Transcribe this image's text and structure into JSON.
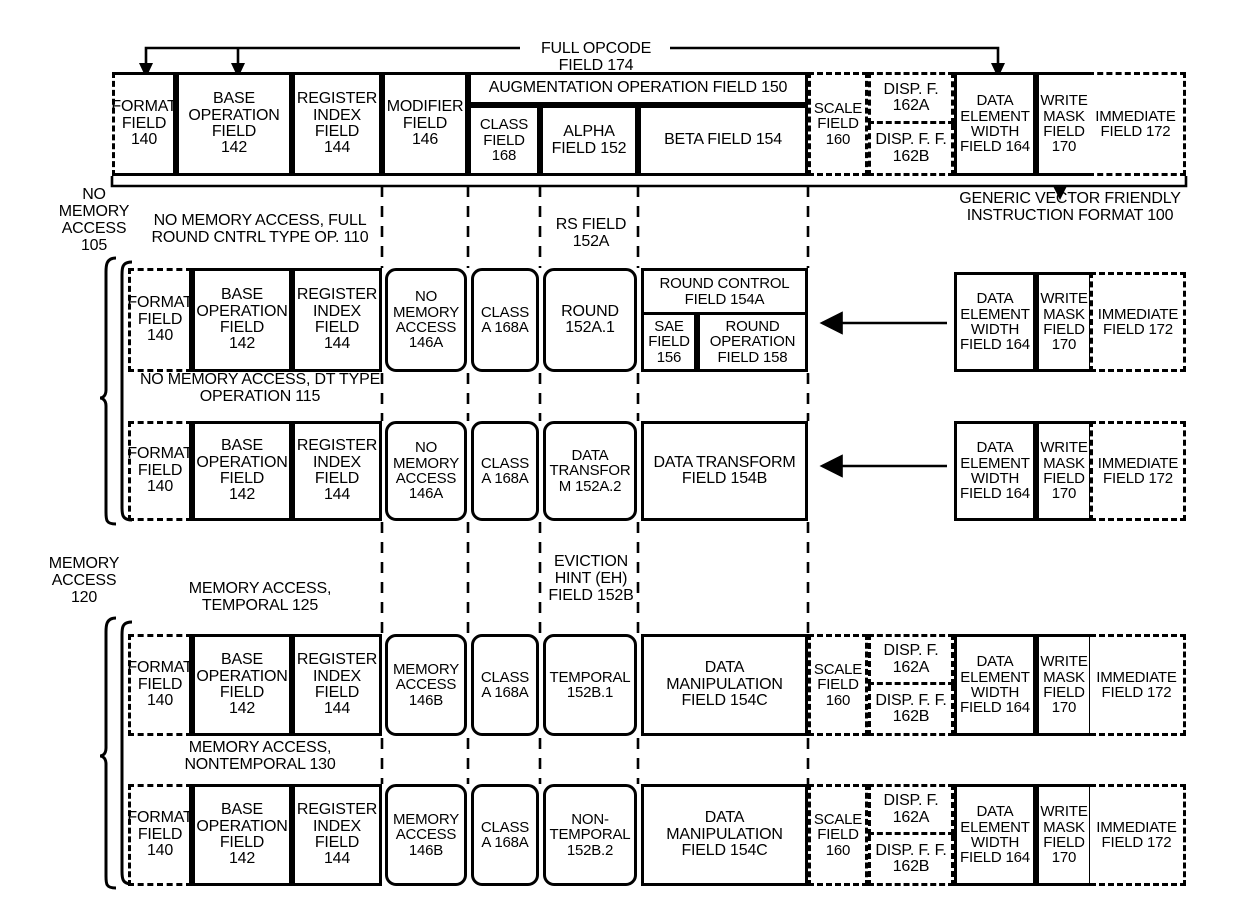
{
  "diagram": {
    "title": "GENERIC VECTOR FRIENDLY INSTRUCTION FORMAT 100",
    "full_opcode_label": "FULL OPCODE FIELD 174",
    "generic_format_label_l1": "GENERIC VECTOR FRIENDLY",
    "generic_format_label_l2": "INSTRUCTION FORMAT 100"
  },
  "group_labels": {
    "no_memory_access": "NO\nMEMORY\nACCESS\n105",
    "no_memory_access_l1": "NO",
    "no_memory_access_l2": "MEMORY",
    "no_memory_access_l3": "ACCESS",
    "no_memory_access_l4": "105",
    "memory_access_l1": "MEMORY",
    "memory_access_l2": "ACCESS",
    "memory_access_l3": "120",
    "row2_caption_l1": "NO MEMORY ACCESS, FULL",
    "row2_caption_l2": "ROUND CNTRL TYPE OP. 110",
    "row3_caption_l1": "NO MEMORY ACCESS, DT TYPE",
    "row3_caption_l2": "OPERATION 115",
    "row4_caption_l1": "MEMORY ACCESS,",
    "row4_caption_l2": "TEMPORAL 125",
    "row5_caption_l1": "MEMORY ACCESS,",
    "row5_caption_l2": "NONTEMPORAL 130",
    "rs_field_l1": "RS FIELD",
    "rs_field_l2": "152A",
    "eviction_hint_l1": "EVICTION",
    "eviction_hint_l2": "HINT (EH)",
    "eviction_hint_l3": "FIELD 152B"
  },
  "header_row": {
    "format_field": "FORMAT\nFIELD\n140",
    "format_field_l1": "FORMAT",
    "format_field_l2": "FIELD",
    "format_field_l3": "140",
    "base_operation_l1": "BASE",
    "base_operation_l2": "OPERATION",
    "base_operation_l3": "FIELD",
    "base_operation_l4": "142",
    "register_index_l1": "REGISTER",
    "register_index_l2": "INDEX",
    "register_index_l3": "FIELD",
    "register_index_l4": "144",
    "modifier_l1": "MODIFIER",
    "modifier_l2": "FIELD",
    "modifier_l3": "146",
    "augmentation": "AUGMENTATION OPERATION FIELD 150",
    "class_field_l1": "CLASS",
    "class_field_l2": "FIELD",
    "class_field_l3": "168",
    "alpha_field_l1": "ALPHA",
    "alpha_field_l2": "FIELD 152",
    "beta_field": "BETA FIELD 154",
    "scale_field_l1": "SCALE",
    "scale_field_l2": "FIELD",
    "scale_field_l3": "160",
    "disp_f_l1": "DISP. F.",
    "disp_f_l2": "162A",
    "disp_ff_l1": "DISP. F. F.",
    "disp_ff_l2": "162B",
    "data_element_width_l1": "DATA",
    "data_element_width_l2": "ELEMENT",
    "data_element_width_l3": "WIDTH",
    "data_element_width_l4": "FIELD 164",
    "write_mask_l1": "WRITE",
    "write_mask_l2": "MASK",
    "write_mask_l3": "FIELD",
    "write_mask_l4": "170",
    "immediate_l1": "IMMEDIATE",
    "immediate_l2": "FIELD 172"
  },
  "row_round": {
    "format_field_l1": "FORMAT",
    "format_field_l2": "FIELD",
    "format_field_l3": "140",
    "base_operation_l1": "BASE",
    "base_operation_l2": "OPERATION",
    "base_operation_l3": "FIELD",
    "base_operation_l4": "142",
    "register_index_l1": "REGISTER",
    "register_index_l2": "INDEX",
    "register_index_l3": "FIELD",
    "register_index_l4": "144",
    "no_mem_access_l1": "NO",
    "no_mem_access_l2": "MEMORY",
    "no_mem_access_l3": "ACCESS",
    "no_mem_access_l4": "146A",
    "class_a_l1": "CLASS",
    "class_a_l2": "A 168A",
    "round_l1": "ROUND",
    "round_l2": "152A.1",
    "round_control_l1": "ROUND CONTROL",
    "round_control_l2": "FIELD 154A",
    "sae_l1": "SAE",
    "sae_l2": "FIELD",
    "sae_l3": "156",
    "round_op_l1": "ROUND",
    "round_op_l2": "OPERATION",
    "round_op_l3": "FIELD 158",
    "data_element_width_l1": "DATA",
    "data_element_width_l2": "ELEMENT",
    "data_element_width_l3": "WIDTH",
    "data_element_width_l4": "FIELD 164",
    "write_mask_l1": "WRITE",
    "write_mask_l2": "MASK",
    "write_mask_l3": "FIELD",
    "write_mask_l4": "170",
    "immediate_l1": "IMMEDIATE",
    "immediate_l2": "FIELD 172"
  },
  "row_dt": {
    "format_field_l1": "FORMAT",
    "format_field_l2": "FIELD",
    "format_field_l3": "140",
    "base_operation_l1": "BASE",
    "base_operation_l2": "OPERATION",
    "base_operation_l3": "FIELD",
    "base_operation_l4": "142",
    "register_index_l1": "REGISTER",
    "register_index_l2": "INDEX",
    "register_index_l3": "FIELD",
    "register_index_l4": "144",
    "no_mem_access_l1": "NO",
    "no_mem_access_l2": "MEMORY",
    "no_mem_access_l3": "ACCESS",
    "no_mem_access_l4": "146A",
    "class_a_l1": "CLASS",
    "class_a_l2": "A 168A",
    "data_transform_l1": "DATA",
    "data_transform_l2": "TRANSFOR",
    "data_transform_l3": "M 152A.2",
    "data_transform_field_l1": "DATA TRANSFORM",
    "data_transform_field_l2": "FIELD 154B",
    "data_element_width_l1": "DATA",
    "data_element_width_l2": "ELEMENT",
    "data_element_width_l3": "WIDTH",
    "data_element_width_l4": "FIELD 164",
    "write_mask_l1": "WRITE",
    "write_mask_l2": "MASK",
    "write_mask_l3": "FIELD",
    "write_mask_l4": "170",
    "immediate_l1": "IMMEDIATE",
    "immediate_l2": "FIELD 172"
  },
  "row_temporal": {
    "format_field_l1": "FORMAT",
    "format_field_l2": "FIELD",
    "format_field_l3": "140",
    "base_operation_l1": "BASE",
    "base_operation_l2": "OPERATION",
    "base_operation_l3": "FIELD",
    "base_operation_l4": "142",
    "register_index_l1": "REGISTER",
    "register_index_l2": "INDEX",
    "register_index_l3": "FIELD",
    "register_index_l4": "144",
    "mem_access_l1": "MEMORY",
    "mem_access_l2": "ACCESS",
    "mem_access_l3": "146B",
    "class_a_l1": "CLASS",
    "class_a_l2": "A 168A",
    "temporal_l1": "TEMPORAL",
    "temporal_l2": "152B.1",
    "data_manip_l1": "DATA",
    "data_manip_l2": "MANIPULATION",
    "data_manip_l3": "FIELD 154C",
    "scale_field_l1": "SCALE",
    "scale_field_l2": "FIELD",
    "scale_field_l3": "160",
    "disp_f_l1": "DISP. F.",
    "disp_f_l2": "162A",
    "disp_ff_l1": "DISP. F. F.",
    "disp_ff_l2": "162B",
    "data_element_width_l1": "DATA",
    "data_element_width_l2": "ELEMENT",
    "data_element_width_l3": "WIDTH",
    "data_element_width_l4": "FIELD 164",
    "write_mask_l1": "WRITE",
    "write_mask_l2": "MASK",
    "write_mask_l3": "FIELD",
    "write_mask_l4": "170",
    "immediate_l1": "IMMEDIATE",
    "immediate_l2": "FIELD 172"
  },
  "row_nontemporal": {
    "format_field_l1": "FORMAT",
    "format_field_l2": "FIELD",
    "format_field_l3": "140",
    "base_operation_l1": "BASE",
    "base_operation_l2": "OPERATION",
    "base_operation_l3": "FIELD",
    "base_operation_l4": "142",
    "register_index_l1": "REGISTER",
    "register_index_l2": "INDEX",
    "register_index_l3": "FIELD",
    "register_index_l4": "144",
    "mem_access_l1": "MEMORY",
    "mem_access_l2": "ACCESS",
    "mem_access_l3": "146B",
    "class_a_l1": "CLASS",
    "class_a_l2": "A 168A",
    "nontemporal_l1": "NON-",
    "nontemporal_l2": "TEMPORAL",
    "nontemporal_l3": "152B.2",
    "data_manip_l1": "DATA",
    "data_manip_l2": "MANIPULATION",
    "data_manip_l3": "FIELD 154C",
    "scale_field_l1": "SCALE",
    "scale_field_l2": "FIELD",
    "scale_field_l3": "160",
    "disp_f_l1": "DISP. F.",
    "disp_f_l2": "162A",
    "disp_ff_l1": "DISP. F. F.",
    "disp_ff_l2": "162B",
    "data_element_width_l1": "DATA",
    "data_element_width_l2": "ELEMENT",
    "data_element_width_l3": "WIDTH",
    "data_element_width_l4": "FIELD 164",
    "write_mask_l1": "WRITE",
    "write_mask_l2": "MASK",
    "write_mask_l3": "FIELD",
    "write_mask_l4": "170",
    "immediate_l1": "IMMEDIATE",
    "immediate_l2": "FIELD 172"
  }
}
